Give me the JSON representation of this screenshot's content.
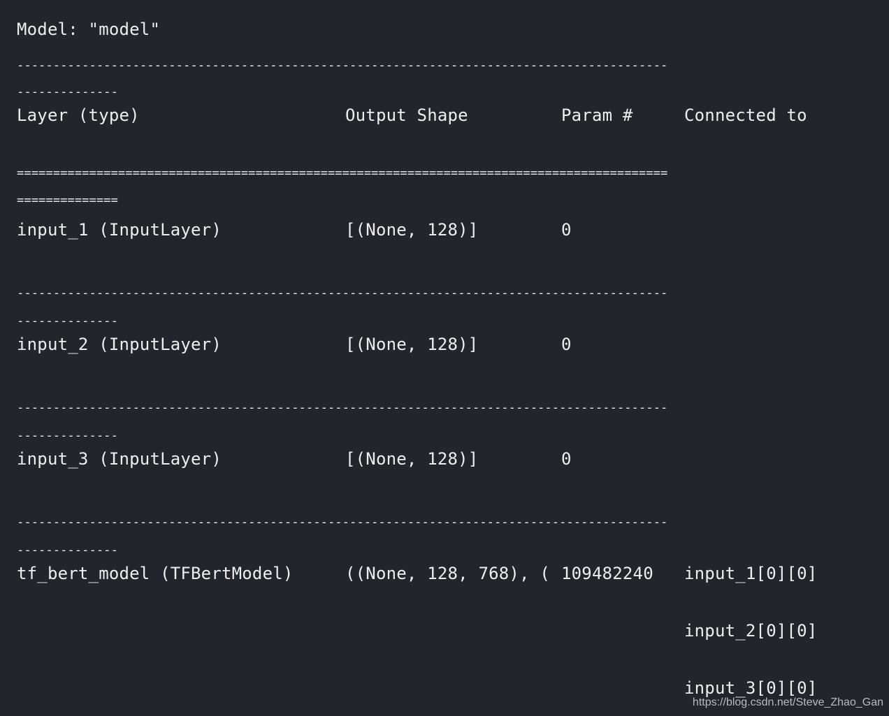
{
  "model_title": "Model: \"model\"",
  "separator_dash_a": "------------------------------------------------------------------------------------------",
  "separator_dash_b": "--------------",
  "separator_eq_a": "==========================================================================================",
  "separator_eq_b": "==============",
  "header": {
    "layer": "Layer (type)",
    "output": "Output Shape",
    "params": "Param #",
    "connected": "Connected to"
  },
  "rows": [
    {
      "layer": "input_1 (InputLayer)",
      "output": "[(None, 128)]",
      "params": "0",
      "connected": [
        "",
        "",
        ""
      ]
    },
    {
      "layer": "input_2 (InputLayer)",
      "output": "[(None, 128)]",
      "params": "0",
      "connected": [
        "",
        "",
        ""
      ]
    },
    {
      "layer": "input_3 (InputLayer)",
      "output": "[(None, 128)]",
      "params": "0",
      "connected": [
        "",
        "",
        ""
      ]
    },
    {
      "layer": "tf_bert_model (TFBertModel)",
      "output": "((None, 128, 768), (",
      "params": "109482240",
      "connected": [
        "input_1[0][0]",
        "input_2[0][0]",
        "input_3[0][0]"
      ]
    }
  ],
  "watermark": "https://blog.csdn.net/Steve_Zhao_Gan"
}
